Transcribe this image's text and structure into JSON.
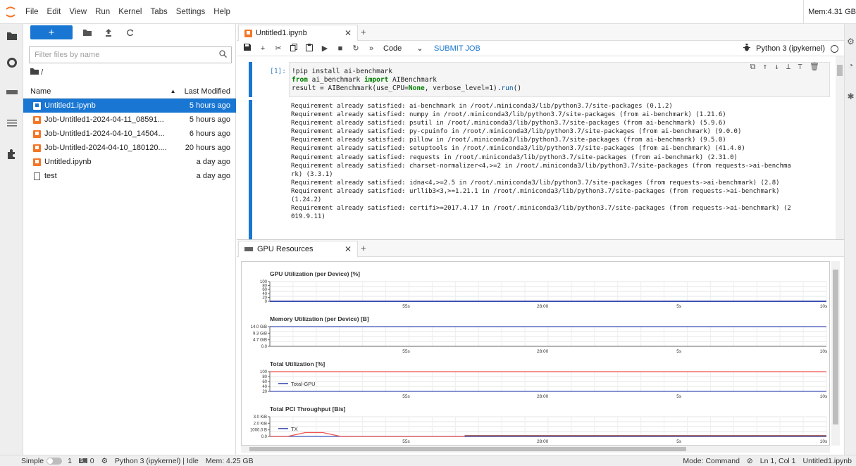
{
  "menu": {
    "items": [
      "File",
      "Edit",
      "View",
      "Run",
      "Kernel",
      "Tabs",
      "Settings",
      "Help"
    ],
    "memory": "Mem:4.31 GB"
  },
  "filebrowser": {
    "filter_placeholder": "Filter files by name",
    "breadcrumb": "/",
    "col_name": "Name",
    "col_modified": "Last Modified",
    "files": [
      {
        "name": "Untitled1.ipynb",
        "modified": "5 hours ago",
        "type": "notebook",
        "selected": true
      },
      {
        "name": "Job-Untitled1-2024-04-11_08591...",
        "modified": "5 hours ago",
        "type": "notebook",
        "selected": false
      },
      {
        "name": "Job-Untitled1-2024-04-10_14504...",
        "modified": "6 hours ago",
        "type": "notebook",
        "selected": false
      },
      {
        "name": "Job-Untitled-2024-04-10_180120....",
        "modified": "20 hours ago",
        "type": "notebook",
        "selected": false
      },
      {
        "name": "Untitled.ipynb",
        "modified": "a day ago",
        "type": "notebook",
        "selected": false
      },
      {
        "name": "test",
        "modified": "a day ago",
        "type": "file",
        "selected": false
      }
    ]
  },
  "notebook": {
    "tab_title": "Untitled1.ipynb",
    "cell_type": "Code",
    "submit_label": "SUBMIT JOB",
    "kernel_name": "Python 3 (ipykernel)",
    "prompt": "[1]:",
    "code_lines": [
      "!pip install ai-benchmark",
      "from ai_benchmark import AIBenchmark",
      "result = AIBenchmark(use_CPU=None, verbose_level=1).run()"
    ],
    "output_lines": [
      "Requirement already satisfied: ai-benchmark in /root/.miniconda3/lib/python3.7/site-packages (0.1.2)",
      "Requirement already satisfied: numpy in /root/.miniconda3/lib/python3.7/site-packages (from ai-benchmark) (1.21.6)",
      "Requirement already satisfied: psutil in /root/.miniconda3/lib/python3.7/site-packages (from ai-benchmark) (5.9.6)",
      "Requirement already satisfied: py-cpuinfo in /root/.miniconda3/lib/python3.7/site-packages (from ai-benchmark) (9.0.0)",
      "Requirement already satisfied: pillow in /root/.miniconda3/lib/python3.7/site-packages (from ai-benchmark) (9.5.0)",
      "Requirement already satisfied: setuptools in /root/.miniconda3/lib/python3.7/site-packages (from ai-benchmark) (41.4.0)",
      "Requirement already satisfied: requests in /root/.miniconda3/lib/python3.7/site-packages (from ai-benchmark) (2.31.0)",
      "Requirement already satisfied: charset-normalizer<4,>=2 in /root/.miniconda3/lib/python3.7/site-packages (from requests->ai-benchma",
      "rk) (3.3.1)",
      "Requirement already satisfied: idna<4,>=2.5 in /root/.miniconda3/lib/python3.7/site-packages (from requests->ai-benchmark) (2.8)",
      "Requirement already satisfied: urllib3<3,>=1.21.1 in /root/.miniconda3/lib/python3.7/site-packages (from requests->ai-benchmark)",
      "(1.24.2)",
      "Requirement already satisfied: certifi>=2017.4.17 in /root/.miniconda3/lib/python3.7/site-packages (from requests->ai-benchmark) (2",
      "019.9.11)"
    ]
  },
  "gpu": {
    "tab_title": "GPU Resources"
  },
  "chart_data": [
    {
      "type": "line",
      "title": "GPU Utilization (per Device) [%]",
      "y_ticks": [
        "100",
        "80",
        "60",
        "40",
        "20",
        "0"
      ],
      "x_ticks": [
        "55s",
        "28:00",
        "5s",
        "10s"
      ],
      "ylim": [
        0,
        100
      ],
      "series": [
        {
          "values": [
            0,
            0,
            0,
            0,
            0,
            0,
            0,
            0,
            0,
            0
          ]
        }
      ]
    },
    {
      "type": "line",
      "title": "Memory Utilization (per Device) [B]",
      "y_ticks": [
        "14.0 GiB",
        "9.3 GiB",
        "4.7 GiB",
        "0.0"
      ],
      "x_ticks": [
        "55s",
        "28:00",
        "5s",
        "10s"
      ],
      "ylim": [
        0,
        14
      ],
      "series": [
        {
          "values": [
            14,
            14,
            14,
            14,
            14,
            14,
            14,
            14,
            14,
            14
          ]
        }
      ]
    },
    {
      "type": "line",
      "title": "Total Utilization [%]",
      "y_ticks": [
        "100",
        "80",
        "60",
        "40",
        "20"
      ],
      "x_ticks": [
        "55s",
        "28:00",
        "5s",
        "10s"
      ],
      "ylim": [
        0,
        100
      ],
      "legend": [
        "Total-GPU"
      ],
      "series": [
        {
          "values": [
            0,
            0,
            0,
            0,
            0,
            0,
            0,
            0,
            0,
            0
          ]
        },
        {
          "values": [
            100,
            100,
            100,
            100,
            100,
            100,
            100,
            100,
            100,
            100
          ]
        }
      ]
    },
    {
      "type": "line",
      "title": "Total PCI Throughput [B/s]",
      "y_ticks": [
        "3.0 KiB",
        "2.0 KiB",
        "1000.0 B",
        "0.0"
      ],
      "x_ticks": [
        "55s",
        "28:00",
        "5s",
        "10s"
      ],
      "ylim": [
        0,
        3072
      ],
      "legend": [
        "TX"
      ],
      "series": [
        {
          "values": [
            0,
            0,
            0,
            0,
            0,
            0,
            0,
            0,
            0,
            0
          ]
        },
        {
          "values": [
            0,
            0,
            600,
            600,
            0,
            0,
            0,
            0,
            0,
            0,
            0,
            0
          ]
        }
      ]
    }
  ],
  "status": {
    "mode_label": "Simple",
    "terminals": "1",
    "kernels": "0",
    "kernel_status": "Python 3 (ipykernel) | Idle",
    "memory": "Mem: 4.25 GB",
    "mode": "Mode: Command",
    "position": "Ln 1, Col 1",
    "file": "Untitled1.ipynb"
  },
  "colors": {
    "accent": "#1976d2",
    "notebook_icon": "#f37626",
    "series_blue": "#3f51b5",
    "series_red": "#ef5350"
  }
}
